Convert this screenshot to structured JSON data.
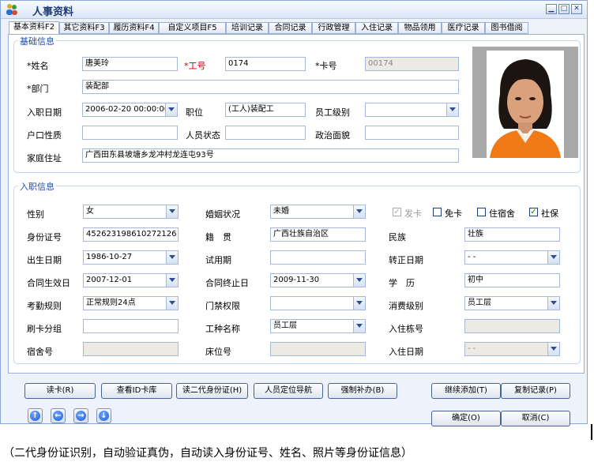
{
  "window": {
    "title": "人事资料"
  },
  "tabs": [
    "基本资料F2",
    "其它资料F3",
    "履历资料F4",
    "自定义项目F5",
    "培训记录",
    "合同记录",
    "行政管理",
    "入住记录",
    "物品领用",
    "医疗记录",
    "图书借阅"
  ],
  "basic": {
    "group_label": "基础信息",
    "name_label": "*姓名",
    "name_value": "唐美玲",
    "empno_label": "*工号",
    "empno_value": "0174",
    "cardno_label": "*卡号",
    "cardno_value": "00174",
    "dept_label": "*部门",
    "dept_value": "装配部",
    "joindate_label": "入职日期",
    "joindate_value": "2006-02-20 00:00:00",
    "position_label": "职位",
    "position_value": "(工人)装配工",
    "level_label": "员工级别",
    "level_value": "",
    "hukou_label": "户口性质",
    "hukou_value": "",
    "status_label": "人员状态",
    "status_value": "",
    "politics_label": "政治面貌",
    "politics_value": "",
    "address_label": "家庭住址",
    "address_value": "广西田东县坡塘乡龙冲村龙连屯93号"
  },
  "entry": {
    "group_label": "入职信息",
    "gender_label": "性别",
    "gender_value": "女",
    "marital_label": "婚姻状况",
    "marital_value": "未婚",
    "issue_card_label": "发卡",
    "free_card_label": "免卡",
    "dorm_label": "住宿舍",
    "social_label": "社保",
    "idno_label": "身份证号",
    "idno_value": "452623198610272126",
    "native_label": "籍　贯",
    "native_value": "广西壮族自治区",
    "ethnic_label": "民族",
    "ethnic_value": "壮族",
    "birth_label": "出生日期",
    "birth_value": "1986-10-27",
    "probation_label": "试用期",
    "probation_value": "",
    "regular_label": "转正日期",
    "regular_value": "- -",
    "cstart_label": "合同生效日",
    "cstart_value": "2007-12-01",
    "cend_label": "合同终止日",
    "cend_value": "2009-11-30",
    "edu_label": "学　历",
    "edu_value": "初中",
    "attend_label": "考勤规则",
    "attend_value": "正常规则24点",
    "door_label": "门禁权限",
    "door_value": "",
    "consume_label": "消费级别",
    "consume_value": "员工层",
    "swipe_label": "刷卡分组",
    "swipe_value": "",
    "worktype_label": "工种名称",
    "worktype_value": "员工层",
    "building_label": "入住栋号",
    "building_value": "",
    "room_label": "宿舍号",
    "room_value": "",
    "bed_label": "床位号",
    "bed_value": "",
    "checkin_label": "入住日期",
    "checkin_value": "- -"
  },
  "buttons": {
    "read_card": "读卡(R)",
    "view_id": "查看ID卡库",
    "read_id2": "读二代身份证(H)",
    "locate": "人员定位导航",
    "force": "强制补办(B)",
    "continue_add": "继续添加(T)",
    "copy": "复制记录(P)",
    "ok": "确定(O)",
    "cancel": "取消(C)"
  },
  "caption": "（二代身份证识别，自动验证真伪，自动读入身份证号、姓名、照片等身份证信息）",
  "colors": {
    "accent": "#1d4db5",
    "required": "#c00000"
  }
}
